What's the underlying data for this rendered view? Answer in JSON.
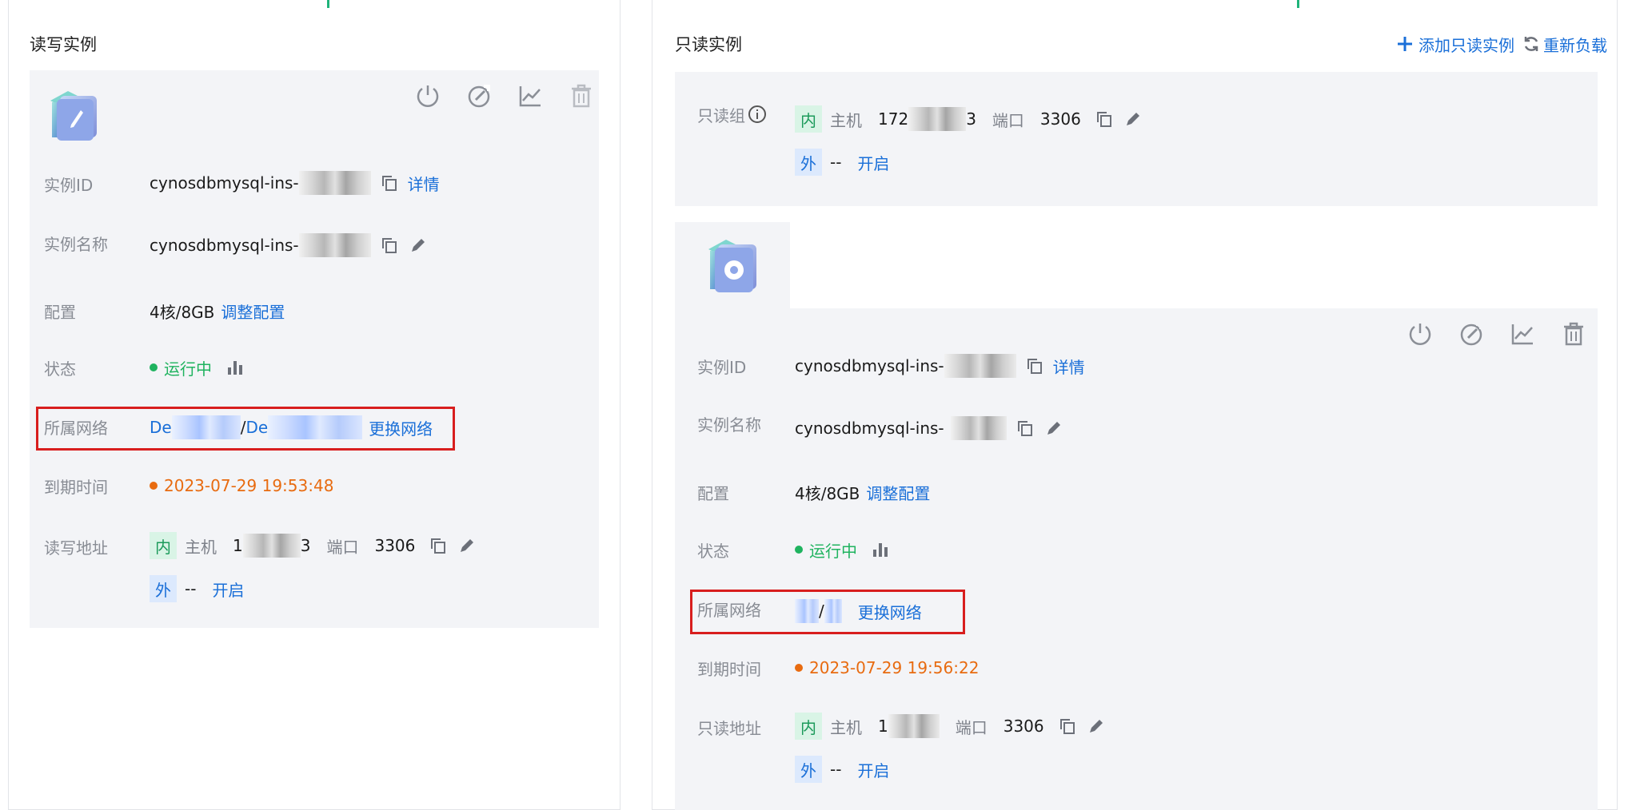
{
  "left": {
    "title": "读写实例",
    "instance_id_label": "实例ID",
    "instance_id_value": "cynosdbmysql-ins-",
    "detail_link": "详情",
    "instance_name_label": "实例名称",
    "instance_name_value": "cynosdbmysql-ins-",
    "config_label": "配置",
    "config_value": "4核/8GB",
    "adjust_config_link": "调整配置",
    "status_label": "状态",
    "status_value": "运行中",
    "network_label": "所属网络",
    "network_prefix_1": "De",
    "network_separator": " /",
    "network_prefix_2": "De",
    "change_network_link": "更换网络",
    "expire_label": "到期时间",
    "expire_value": "2023-07-29 19:53:48",
    "address_label": "读写地址",
    "inner_tag": "内",
    "host_label": "主机",
    "host_value_start": "1",
    "host_value_end": "3",
    "port_label": "端口",
    "port_value": "3306",
    "outer_tag": "外",
    "outer_value": "--",
    "enable_link": "开启"
  },
  "right": {
    "title": "只读实例",
    "add_readonly_button": "添加只读实例",
    "reload_button": "重新负载",
    "group_label": "只读组",
    "group_inner_tag": "内",
    "group_host_label": "主机",
    "group_host_value_start": "172",
    "group_host_value_end": "3",
    "group_port_label": "端口",
    "group_port_value": "3306",
    "group_outer_tag": "外",
    "group_outer_value": "--",
    "group_enable_link": "开启",
    "instance_id_label": "实例ID",
    "instance_id_value": "cynosdbmysql-ins-",
    "detail_link": "详情",
    "instance_name_label": "实例名称",
    "instance_name_value": "cynosdbmysql-ins-",
    "config_label": "配置",
    "config_value": "4核/8GB",
    "adjust_config_link": "调整配置",
    "status_label": "状态",
    "status_value": "运行中",
    "network_label": "所属网络",
    "network_separator": " / ",
    "change_network_link": "更换网络",
    "expire_label": "到期时间",
    "expire_value": "2023-07-29 19:56:22",
    "address_label": "只读地址",
    "inner_tag": "内",
    "host_label": "主机",
    "host_value_start": "1",
    "port_label": "端口",
    "port_value": "3306",
    "outer_tag": "外",
    "outer_value": "--",
    "enable_link": "开启"
  },
  "colors": {
    "link": "#1a6fd8",
    "running": "#1fb35f",
    "expire": "#e86b10",
    "highlight": "#d81e1e",
    "card_bg": "#f3f4f7"
  },
  "icons": [
    "power-icon",
    "gauge-icon",
    "chart-line-icon",
    "trash-icon",
    "copy-icon",
    "edit-icon",
    "bar-chart-icon",
    "info-icon",
    "plus-icon",
    "refresh-icon",
    "database-logo"
  ]
}
